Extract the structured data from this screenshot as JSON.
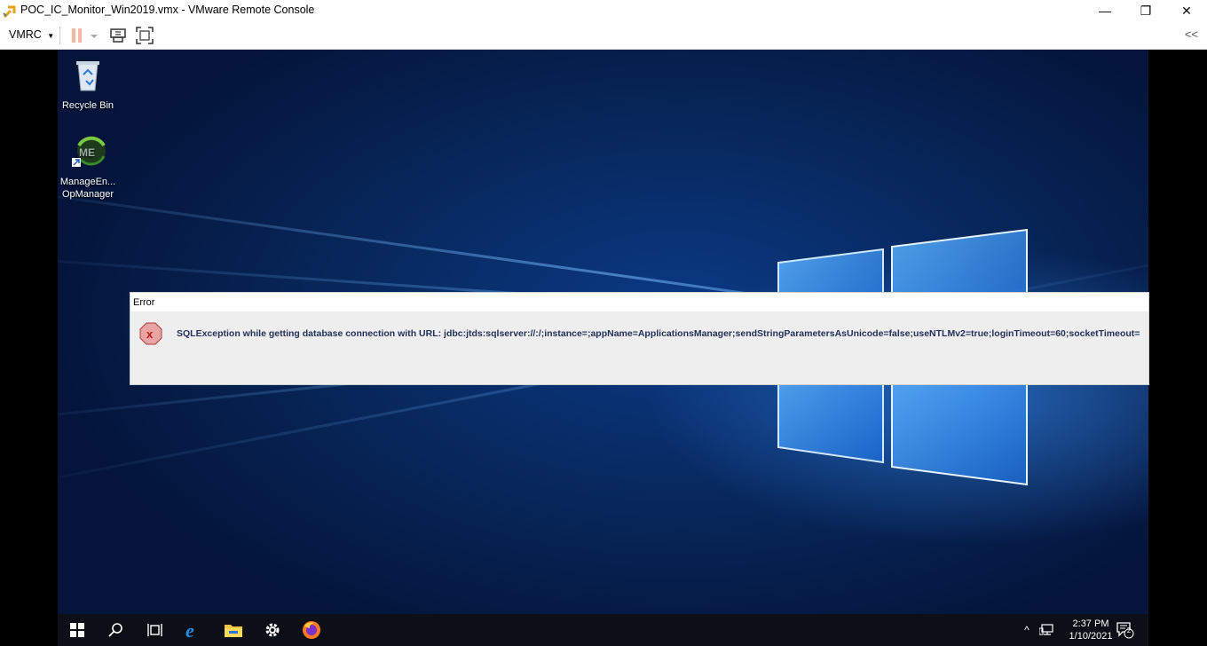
{
  "window": {
    "title": "POC_IC_Monitor_Win2019.vmx - VMware Remote Console",
    "controls": {
      "minimize": "—",
      "restore": "❐",
      "close": "✕"
    }
  },
  "toolbar": {
    "vmrc_menu": "VMRC",
    "collapse": "<<",
    "icons": [
      "pause-icon",
      "dropdown-arrow-icon",
      "send-ctrl-alt-del-icon",
      "fullscreen-icon"
    ]
  },
  "desktop": {
    "icons": [
      {
        "name": "recycle-bin",
        "label": "Recycle Bin"
      },
      {
        "name": "manageengine",
        "label_line1": "ManageEn...",
        "label_line2": "OpManager"
      }
    ]
  },
  "dialog": {
    "title": "Error",
    "message": "SQLException while getting database connection  with URL: jdbc:jtds:sqlserver://:/;instance=;appName=ApplicationsManager;sendStringParametersAsUnicode=false;useNTLMv2=true;loginTimeout=60;socketTimeout="
  },
  "taskbar": {
    "items": [
      "start-icon",
      "search-icon",
      "task-view-icon",
      "edge-icon",
      "file-explorer-icon",
      "settings-icon",
      "firefox-icon"
    ],
    "clock_time": "2:37 PM",
    "clock_date": "1/10/2021",
    "notifications_count": "2"
  },
  "colors": {
    "accent": "#f0b020",
    "error_red": "#d33a3a",
    "desktop_blue": "#0b3a86"
  }
}
